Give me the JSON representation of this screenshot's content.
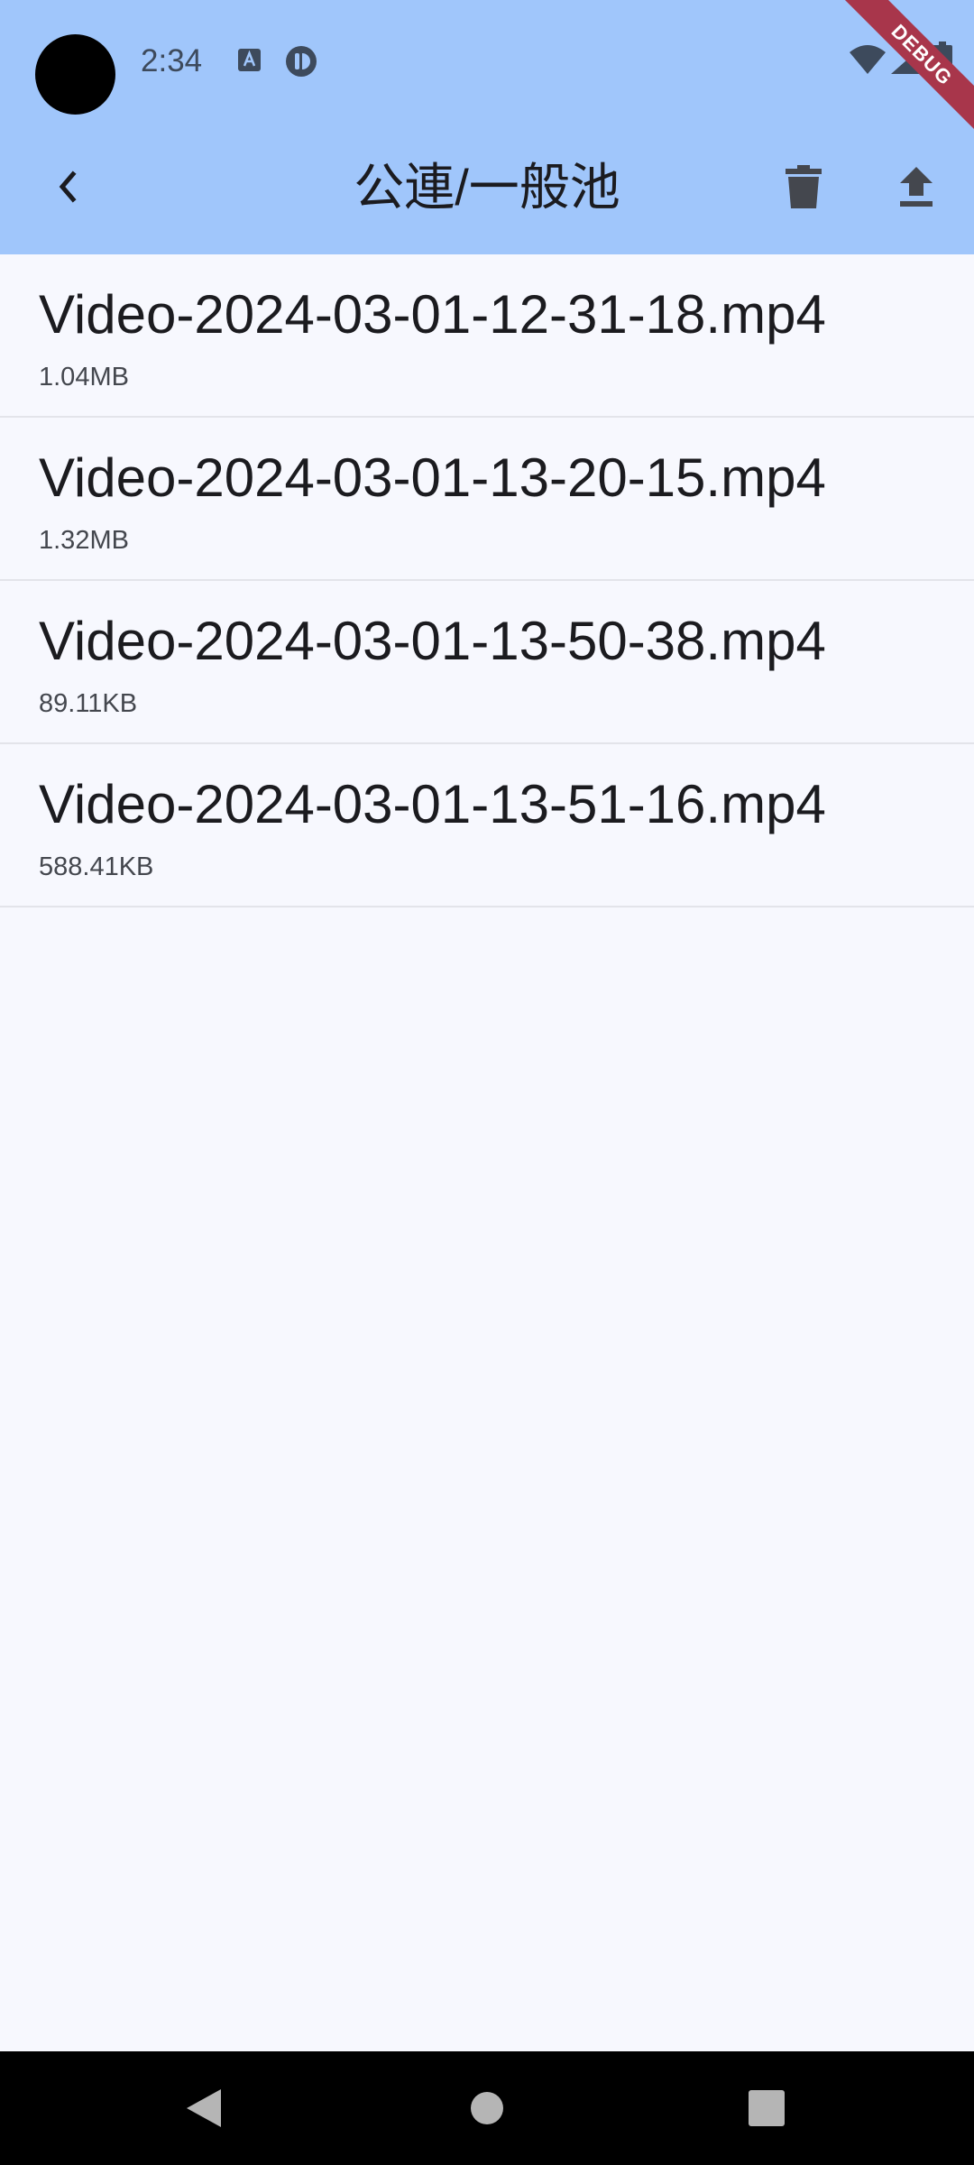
{
  "status_bar": {
    "time": "2:34",
    "icons": [
      "camera-cutout",
      "notification-a-icon",
      "notification-b-icon",
      "wifi-icon",
      "signal-icon",
      "battery-icon"
    ]
  },
  "debug_banner": {
    "label": "DEBUG"
  },
  "app_bar": {
    "title": "公連/一般池",
    "back_icon": "chevron-left-icon",
    "actions": [
      {
        "name": "delete",
        "icon": "trash-icon"
      },
      {
        "name": "upload",
        "icon": "upload-icon"
      }
    ]
  },
  "files": [
    {
      "name": "Video-2024-03-01-12-31-18.mp4",
      "size": "1.04MB"
    },
    {
      "name": "Video-2024-03-01-13-20-15.mp4",
      "size": "1.32MB"
    },
    {
      "name": "Video-2024-03-01-13-50-38.mp4",
      "size": "89.11KB"
    },
    {
      "name": "Video-2024-03-01-13-51-16.mp4",
      "size": "588.41KB"
    }
  ],
  "colors": {
    "app_bar_bg": "#a0c6fb",
    "page_bg": "#f7f8fe",
    "divider": "#e3e4ea",
    "debug_ribbon": "#a8364b"
  }
}
